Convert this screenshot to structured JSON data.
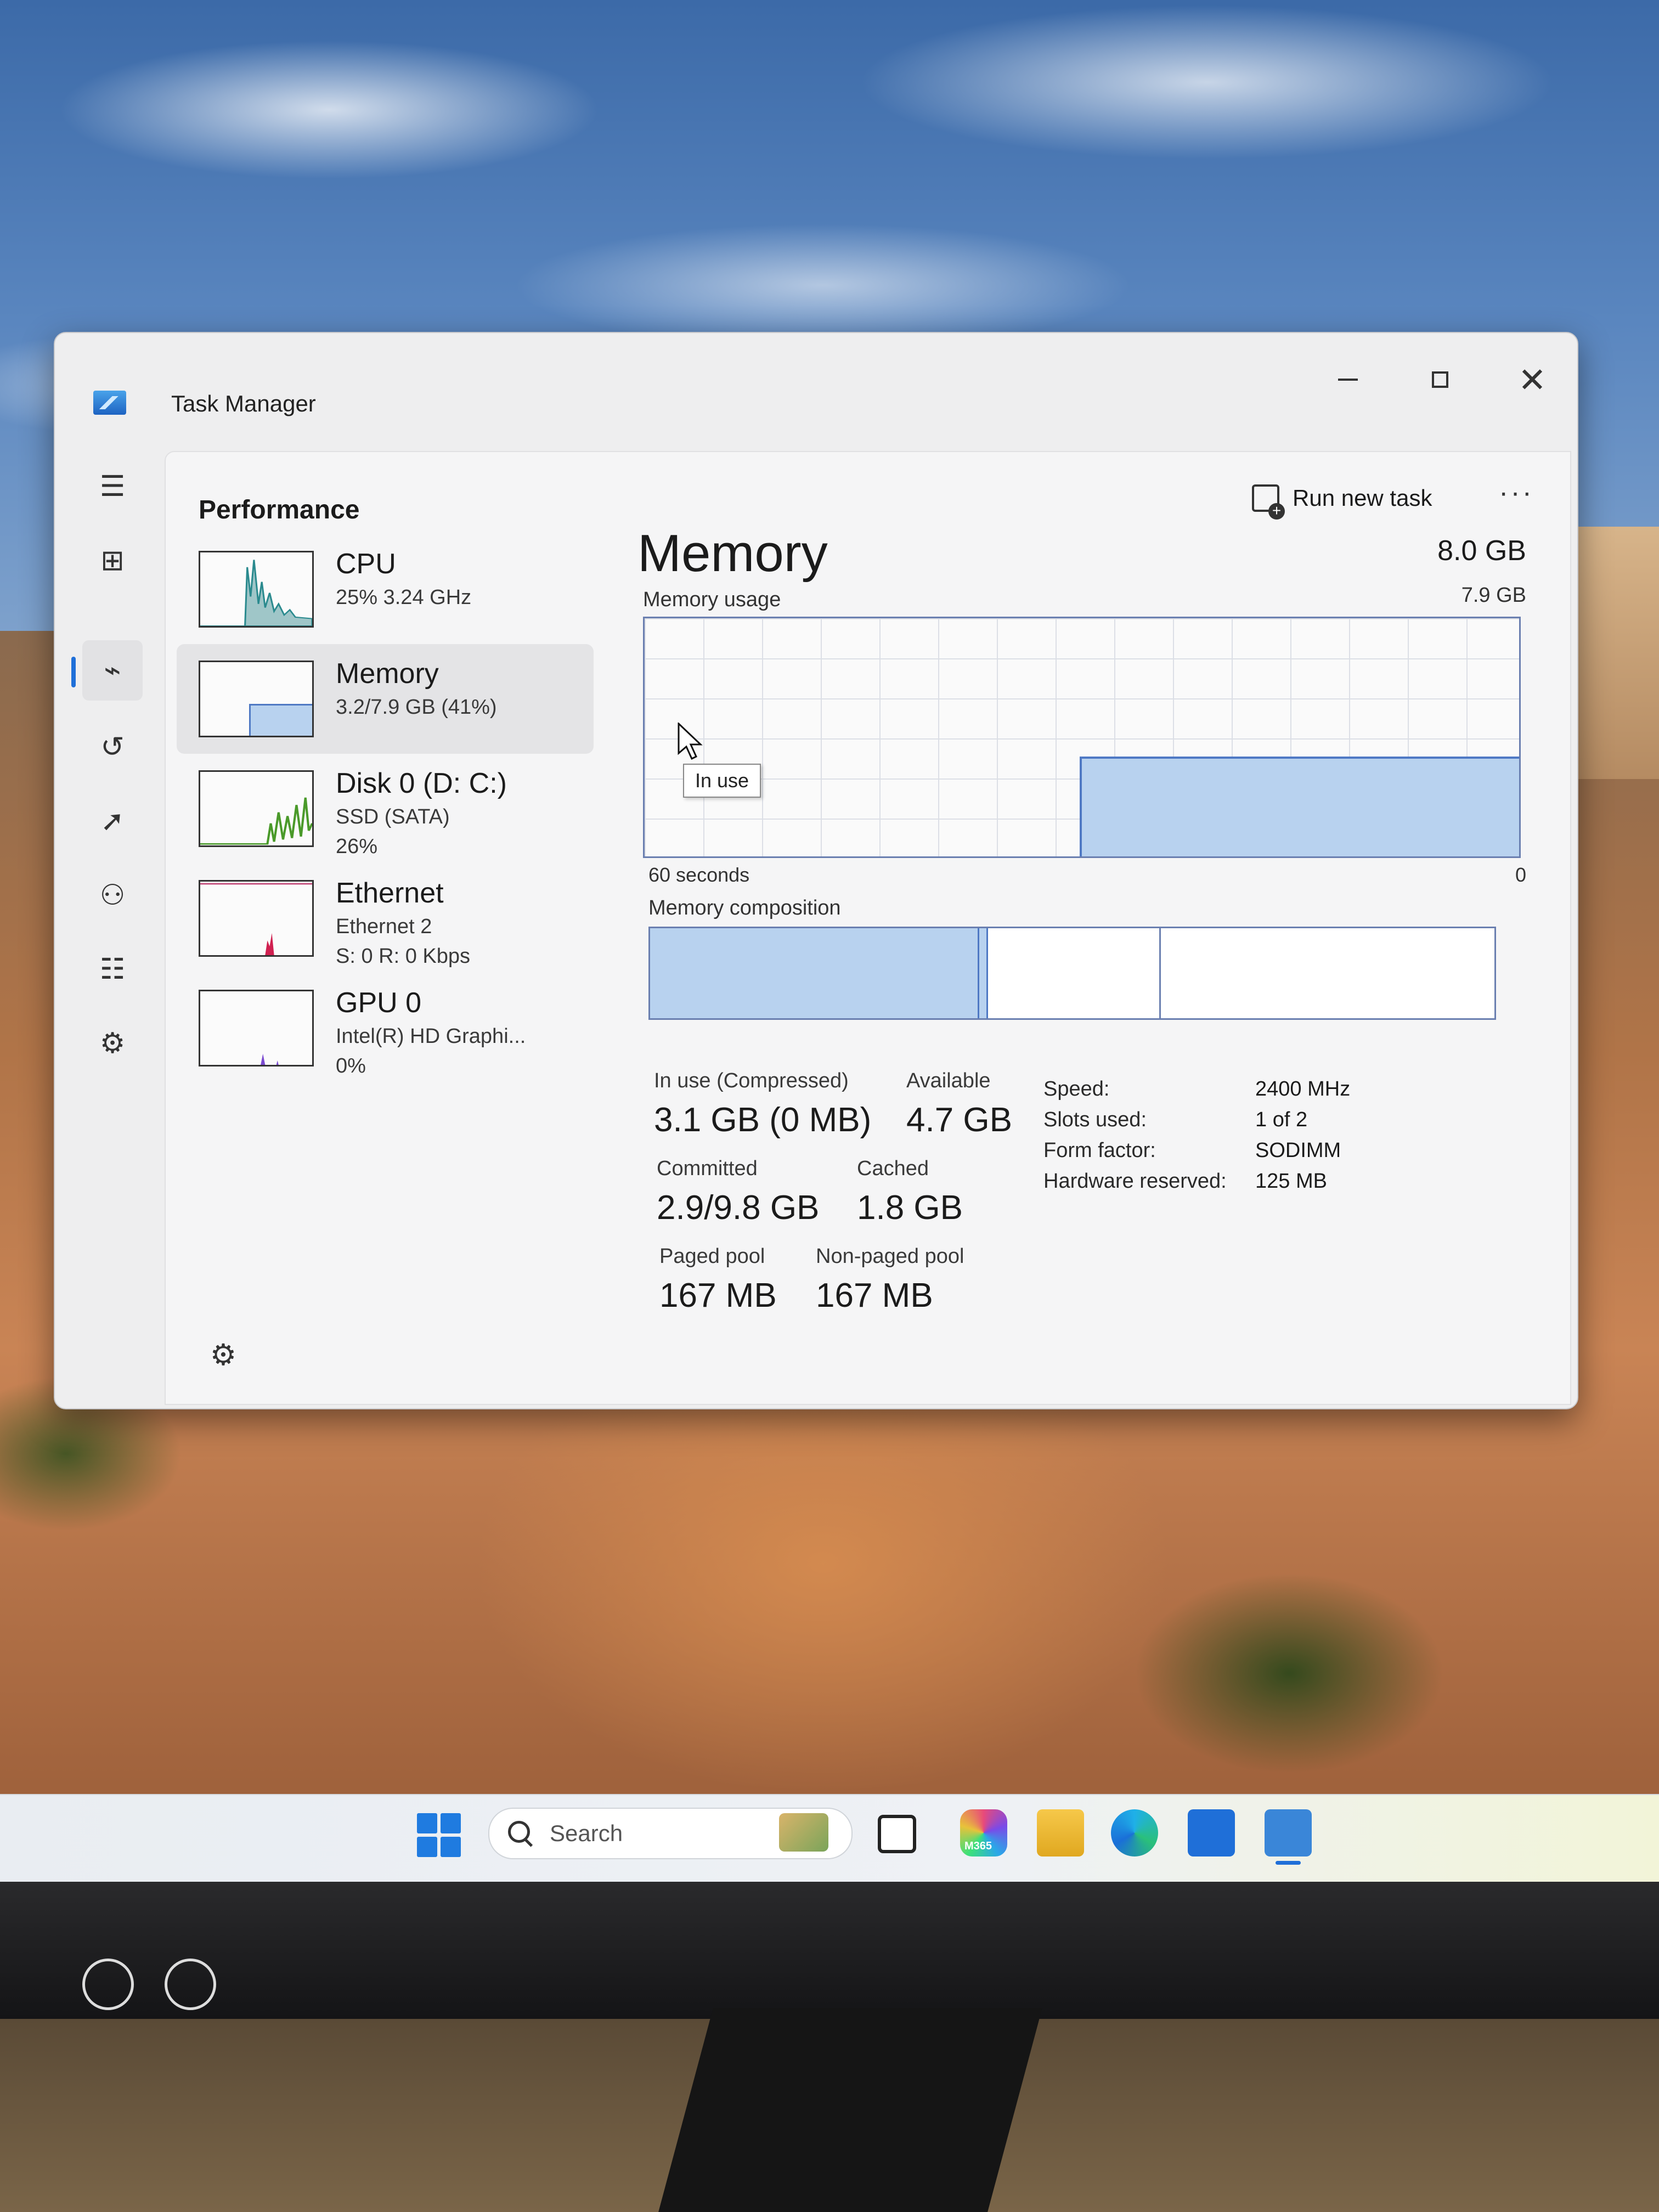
{
  "window": {
    "title": "Task Manager",
    "controls": {
      "minimize_icon": "minimize-icon",
      "maximize_icon": "maximize-icon",
      "close_icon": "close-icon"
    }
  },
  "header": {
    "page_title": "Performance",
    "run_new_task_label": "Run new task",
    "more_label": "···"
  },
  "nav_rail": {
    "items": [
      {
        "icon": "hamburger-icon",
        "glyph": "☰"
      },
      {
        "icon": "processes-icon",
        "glyph": "⊞"
      },
      {
        "icon": "performance-icon",
        "glyph": "⌁",
        "active": true
      },
      {
        "icon": "app-history-icon",
        "glyph": "↺"
      },
      {
        "icon": "startup-apps-icon",
        "glyph": "➚"
      },
      {
        "icon": "users-icon",
        "glyph": "👥"
      },
      {
        "icon": "details-icon",
        "glyph": "☰"
      },
      {
        "icon": "services-icon",
        "glyph": "⚙"
      }
    ],
    "settings_glyph": "⚙"
  },
  "devices": [
    {
      "name": "CPU",
      "line1": "25% 3.24 GHz",
      "line2": ""
    },
    {
      "name": "Memory",
      "line1": "3.2/7.9 GB (41%)",
      "line2": "",
      "selected": true
    },
    {
      "name": "Disk 0 (D: C:)",
      "line1": "SSD (SATA)",
      "line2": "26%"
    },
    {
      "name": "Ethernet",
      "line1": "Ethernet 2",
      "line2": "S: 0 R: 0 Kbps"
    },
    {
      "name": "GPU 0",
      "line1": "Intel(R) HD Graphi...",
      "line2": "0%"
    }
  ],
  "memory": {
    "heading": "Memory",
    "total": "8.0 GB",
    "usage_label": "Memory usage",
    "usage_max": "7.9 GB",
    "usage_fraction": 0.41,
    "graph_left_label": "60 seconds",
    "graph_right_label": "0",
    "tooltip": "In use",
    "composition_label": "Memory composition",
    "composition": {
      "in_use": 0.39,
      "modified": 0.01,
      "standby": 0.205
    },
    "stats": {
      "in_use_label": "In use (Compressed)",
      "in_use_value": "3.1 GB (0 MB)",
      "available_label": "Available",
      "available_value": "4.7 GB",
      "committed_label": "Committed",
      "committed_value": "2.9/9.8 GB",
      "cached_label": "Cached",
      "cached_value": "1.8 GB",
      "paged_pool_label": "Paged pool",
      "paged_pool_value": "167 MB",
      "non_paged_pool_label": "Non-paged pool",
      "non_paged_pool_value": "167 MB"
    },
    "specs": [
      {
        "key": "Speed:",
        "value": "2400 MHz"
      },
      {
        "key": "Slots used:",
        "value": "1 of 2"
      },
      {
        "key": "Form factor:",
        "value": "SODIMM"
      },
      {
        "key": "Hardware reserved:",
        "value": "125 MB"
      }
    ]
  },
  "taskbar": {
    "search_placeholder": "Search",
    "m365_label": "M365"
  },
  "colors": {
    "accent": "#1f6fd8",
    "graph_fill": "#b8d2ef",
    "graph_border": "#4f79c4"
  }
}
